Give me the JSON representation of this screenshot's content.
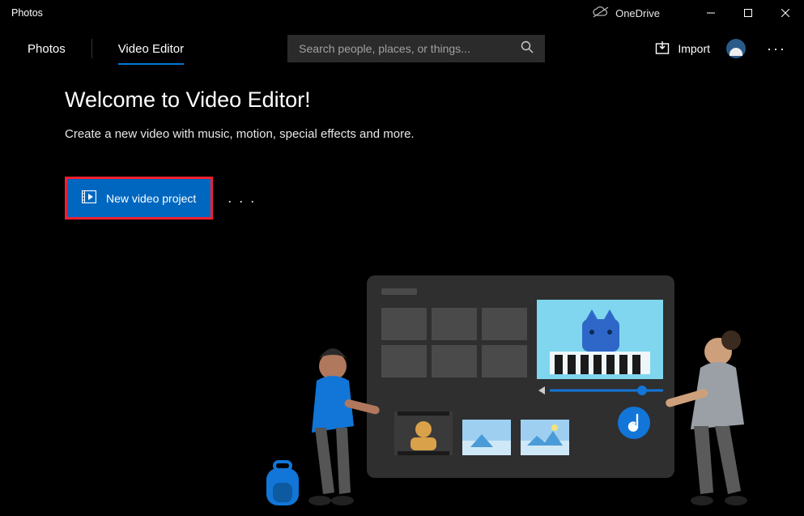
{
  "titlebar": {
    "app_title": "Photos",
    "onedrive_label": "OneDrive"
  },
  "tabs": {
    "photos": "Photos",
    "video_editor": "Video Editor"
  },
  "search": {
    "placeholder": "Search people, places, or things..."
  },
  "toolbar": {
    "import_label": "Import"
  },
  "main": {
    "headline": "Welcome to Video Editor!",
    "subhead": "Create a new video with music, motion, special effects and more.",
    "new_project_label": "New video project"
  }
}
